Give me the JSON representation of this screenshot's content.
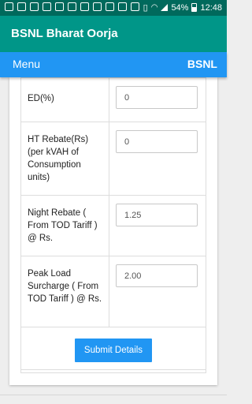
{
  "status_bar": {
    "battery": "54%",
    "time": "12:48"
  },
  "app_bar": {
    "title": "BSNL Bharat Oorja"
  },
  "menu_bar": {
    "menu_label": "Menu",
    "brand": "BSNL"
  },
  "form": {
    "rows": [
      {
        "label": "ED(%)",
        "value": "0"
      },
      {
        "label": "HT Rebate(Rs) (per kVAH of Consumption units)",
        "value": "0"
      },
      {
        "label": "Night Rebate ( From TOD Tariff ) @ Rs.",
        "value": "1.25"
      },
      {
        "label": "Peak Load Surcharge ( From TOD Tariff ) @ Rs.",
        "value": "2.00"
      }
    ],
    "submit_label": "Submit Details"
  },
  "colors": {
    "status_bar": "#00695c",
    "app_bar": "#009688",
    "menu_bar": "#2196f3",
    "button": "#2196f3"
  }
}
